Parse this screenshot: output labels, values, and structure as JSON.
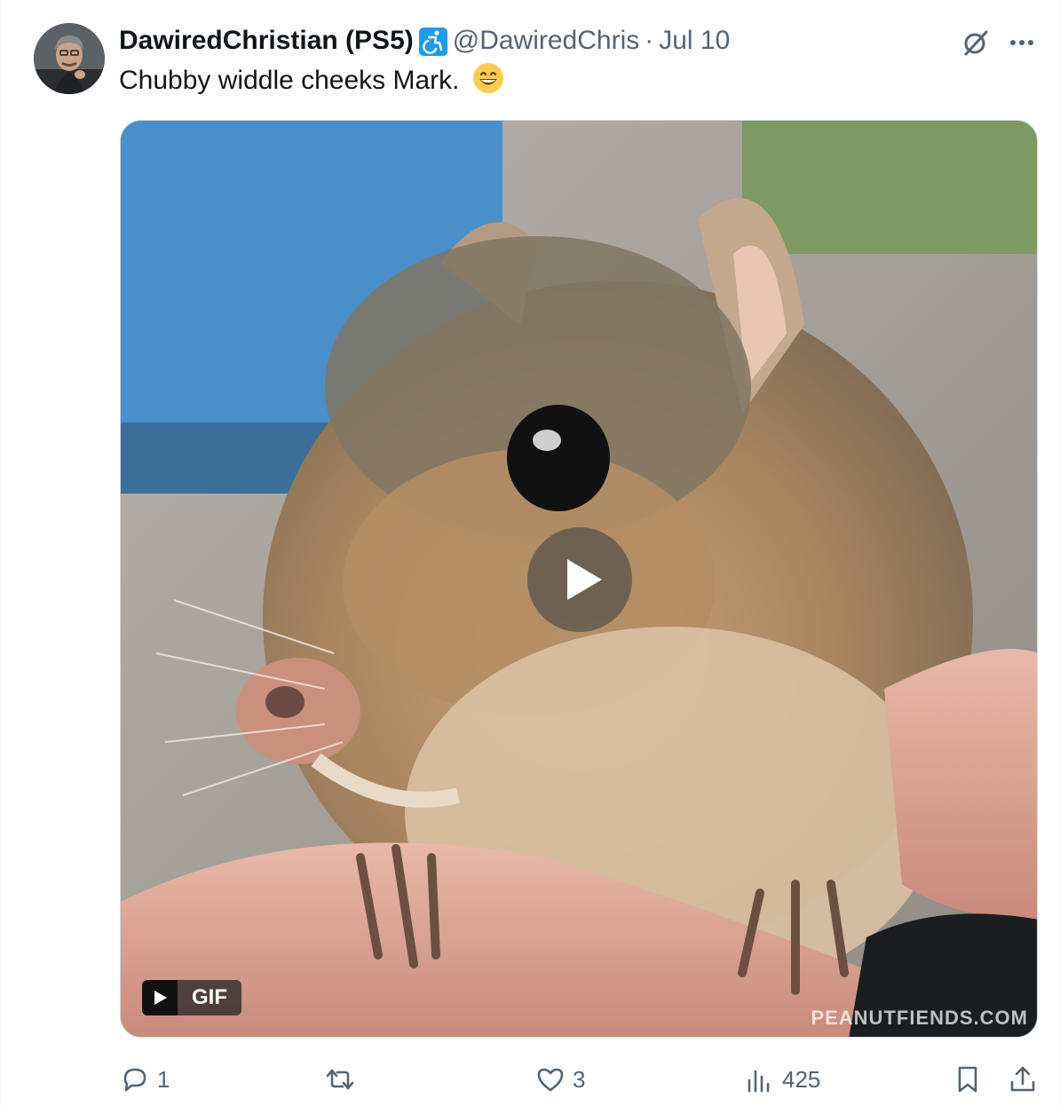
{
  "tweet": {
    "display_name": "DawiredChristian (PS5)",
    "handle": "@DawiredChris",
    "separator": "·",
    "date": "Jul 10",
    "text": "Chubby widdle cheeks Mark."
  },
  "media": {
    "badge_label": "GIF",
    "watermark": "PEANUTFIENDS.COM"
  },
  "actions": {
    "replies": "1",
    "reposts": "",
    "likes": "3",
    "views": "425"
  },
  "colors": {
    "text_primary": "#0f1419",
    "text_secondary": "#536471",
    "accent": "#1d9bf0"
  },
  "icons": [
    "accessibility-badge-icon",
    "grok-icon",
    "more-icon",
    "grinning-emoji-icon",
    "play-icon",
    "reply-icon",
    "repost-icon",
    "like-icon",
    "views-icon",
    "bookmark-icon",
    "share-icon"
  ]
}
